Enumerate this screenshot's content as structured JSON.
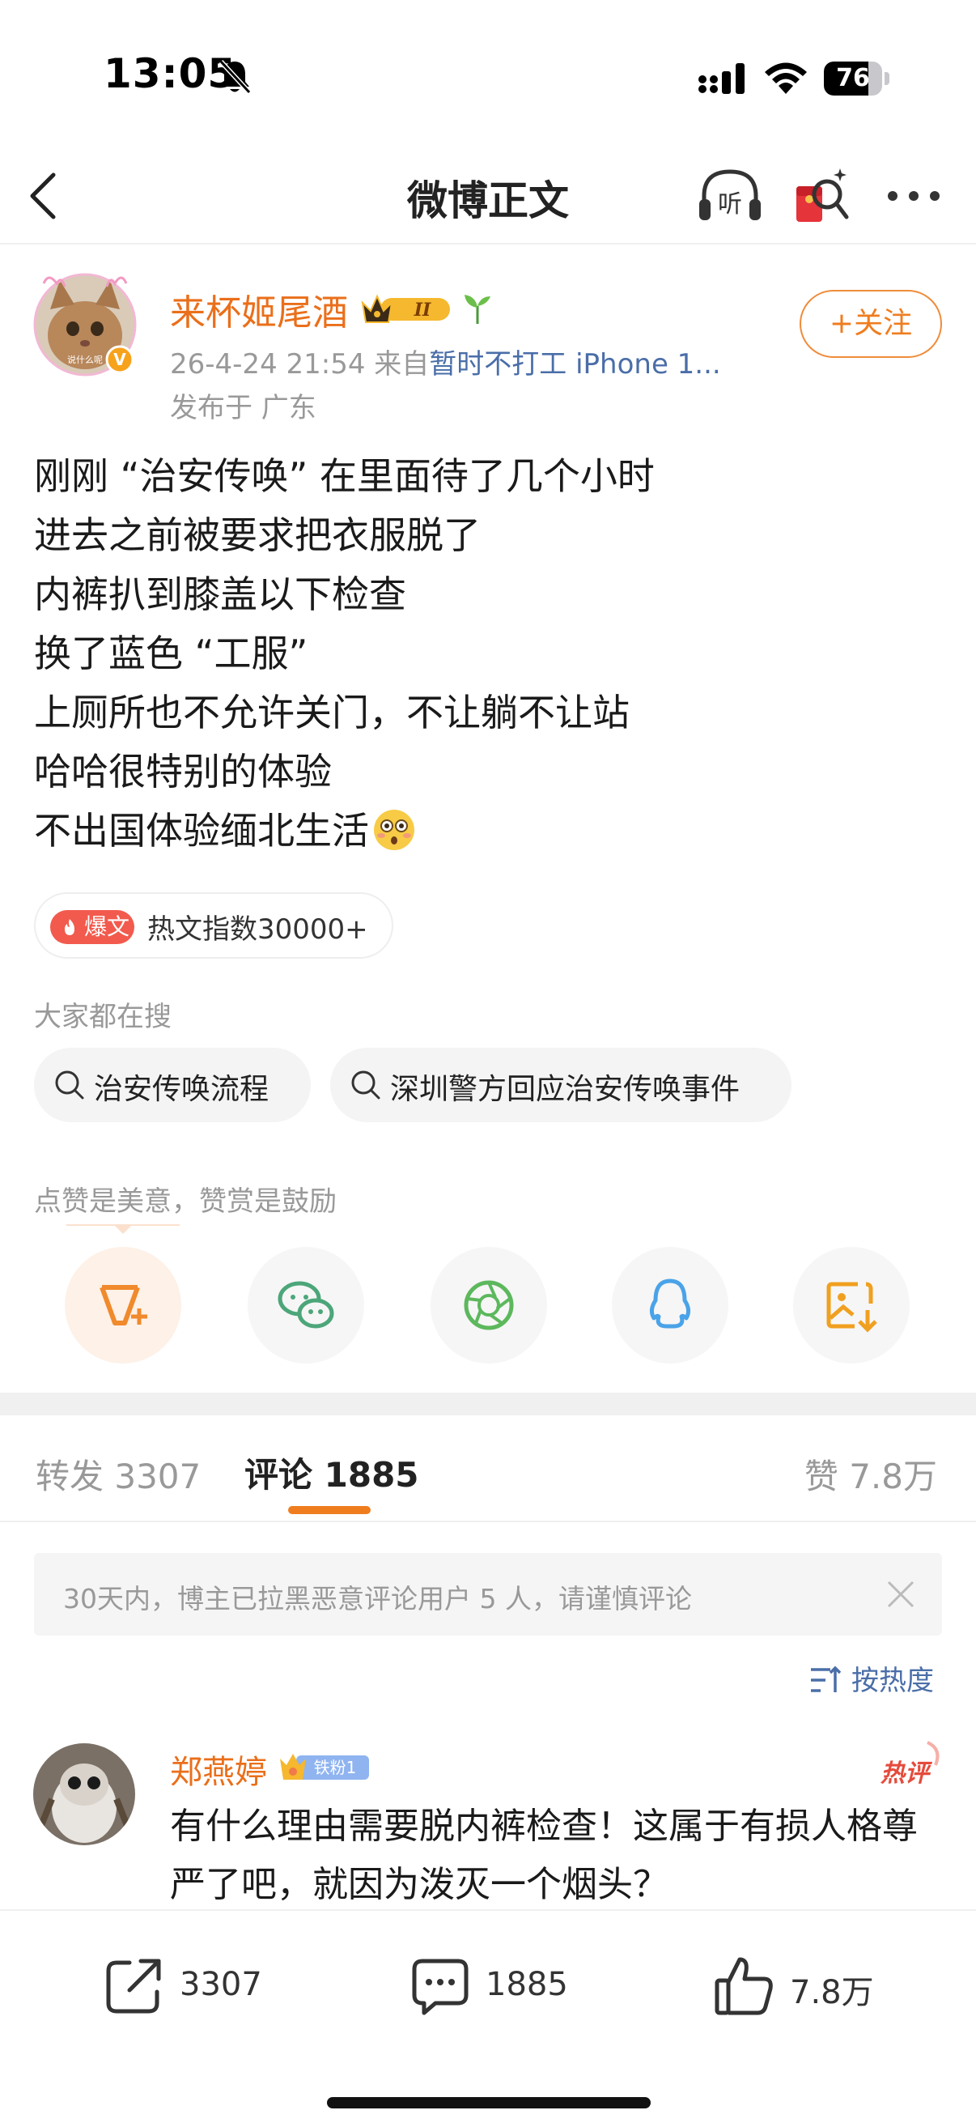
{
  "status_bar": {
    "time": "13:05",
    "battery_level": "76",
    "battery_fraction": 0.76
  },
  "nav": {
    "title": "微博正文"
  },
  "author": {
    "name": "来杯姬尾酒",
    "badge_level": "II",
    "avatar_text": "说什么呢",
    "verified_mark": "V",
    "meta_prefix": "26-4-24 21:54  来自",
    "source": "暂时不打工 iPhone 1...",
    "location": "发布于 广东",
    "follow_label": "+关注"
  },
  "post": {
    "lines": [
      "刚刚 “治安传唤” 在里面待了几个小时",
      "进去之前被要求把衣服脱了",
      "内裤扒到膝盖以下检查",
      "换了蓝色 “工服”",
      "上厕所也不允许关门，不让躺不让站",
      "哈哈很特别的体验",
      "不出国体验缅北生活"
    ]
  },
  "hot": {
    "badge_label": "爆文",
    "index_text": "热文指数30000+"
  },
  "search": {
    "heading": "大家都在搜",
    "chips": [
      "治安传唤流程",
      "深圳警方回应治安传唤事件"
    ]
  },
  "reward": {
    "text": "点赞是美意，赞赏是鼓励"
  },
  "tabs": {
    "repost": "转发 3307",
    "comment": "评论 1885",
    "likes": "赞 7.8万"
  },
  "notice": {
    "text": "30天内，博主已拉黑恶意评论用户 5 人，请谨慎评论"
  },
  "sort": {
    "label": "按热度"
  },
  "comment": {
    "name": "郑燕婷",
    "fan_badge": "铁粉1",
    "hot_tag": "热评",
    "text": "有什么理由需要脱内裤检查！这属于有损人格尊严了吧，就因为泼灭一个烟头？"
  },
  "bottom_bar": {
    "repost_count": "3307",
    "comment_count": "1885",
    "like_count": "7.8万"
  },
  "colors": {
    "accent": "#ef7d1f",
    "name": "#ea6f1a",
    "link": "#4a6ea8",
    "hot": "#f25a4d"
  }
}
